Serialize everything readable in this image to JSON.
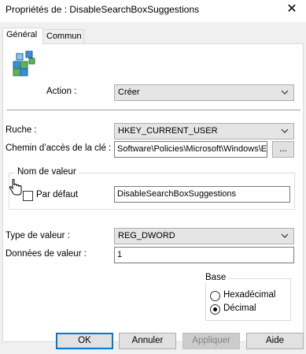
{
  "window": {
    "title": "Propriétés de : DisableSearchBoxSuggestions",
    "close_glyph": "✕"
  },
  "tabs": [
    {
      "label": "Général"
    },
    {
      "label": "Commun"
    }
  ],
  "form": {
    "action_label": "Action :",
    "action_value": "Créer",
    "hive_label": "Ruche :",
    "hive_value": "HKEY_CURRENT_USER",
    "key_path_label": "Chemin d’accès de la clé :",
    "key_path_value": "Software\\Policies\\Microsoft\\Windows\\E",
    "browse_label": "...",
    "value_name_group": "Nom de valeur",
    "default_label": "Par défaut",
    "value_name": "DisableSearchBoxSuggestions",
    "value_type_label": "Type de valeur :",
    "value_type": "REG_DWORD",
    "value_data_label": "Données de valeur :",
    "value_data": "1",
    "base_group": "Base",
    "hex_label": "Hexadécimal",
    "dec_label": "Décimal"
  },
  "buttons": {
    "ok": "OK",
    "cancel": "Annuler",
    "apply": "Appliquer",
    "help": "Aide"
  },
  "colors": {
    "accent": "#0078d7",
    "dialog_bg": "#f0f0f0"
  }
}
